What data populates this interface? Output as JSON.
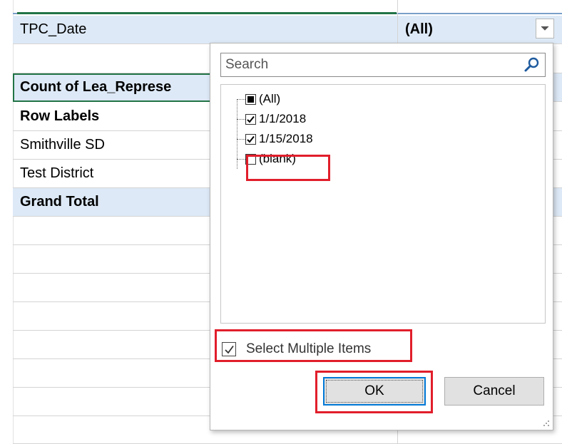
{
  "sheet": {
    "filter_field": "TPC_Date",
    "filter_value": "(All)",
    "value_header": "Count of Lea_Represe",
    "row_labels": "Row Labels",
    "rows": [
      "Smithville SD",
      "Test District"
    ],
    "grand_total": "Grand Total"
  },
  "dialog": {
    "search_placeholder": "Search",
    "items": [
      {
        "label": "(All)",
        "state": "partial"
      },
      {
        "label": "1/1/2018",
        "state": "checked"
      },
      {
        "label": "1/15/2018",
        "state": "checked"
      },
      {
        "label": "(blank)",
        "state": "unchecked"
      }
    ],
    "select_multiple_label": "Select Multiple Items",
    "select_multiple_checked": true,
    "ok_label": "OK",
    "cancel_label": "Cancel"
  },
  "colors": {
    "highlight_red": "#e11e2b",
    "header_blue": "#dde9f6",
    "selection_green": "#217346",
    "focus_blue": "#0078d7"
  }
}
